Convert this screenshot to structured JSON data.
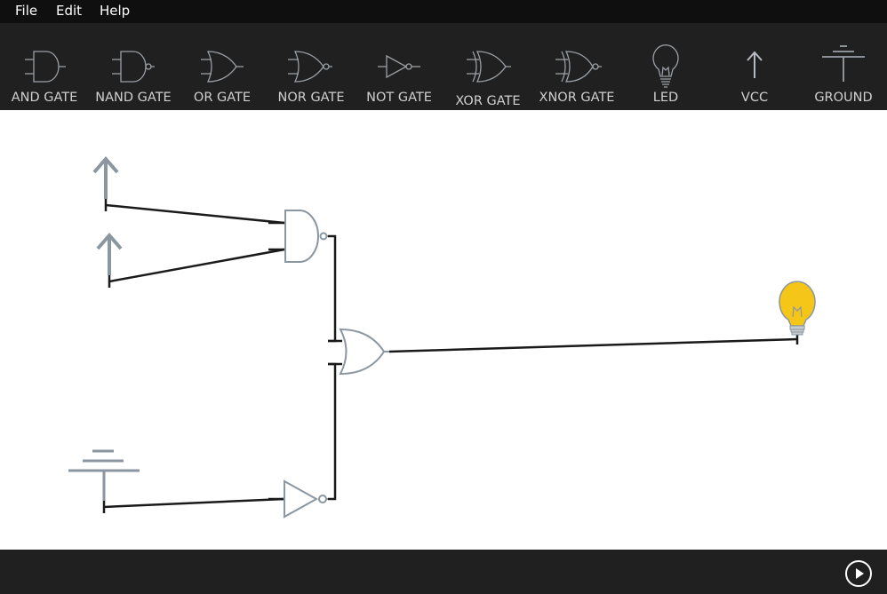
{
  "menubar": {
    "items": [
      {
        "label": "File"
      },
      {
        "label": "Edit"
      },
      {
        "label": "Help"
      }
    ]
  },
  "toolbar": {
    "tools": [
      {
        "label": "AND GATE",
        "icon": "and-gate-icon"
      },
      {
        "label": "NAND GATE",
        "icon": "nand-gate-icon"
      },
      {
        "label": "OR GATE",
        "icon": "or-gate-icon"
      },
      {
        "label": "NOR GATE",
        "icon": "nor-gate-icon"
      },
      {
        "label": "NOT GATE",
        "icon": "not-gate-icon"
      },
      {
        "label": "XOR GATE",
        "icon": "xor-gate-icon"
      },
      {
        "label": "XNOR GATE",
        "icon": "xnor-gate-icon"
      },
      {
        "label": "LED",
        "icon": "lightbulb-icon"
      },
      {
        "label": "VCC",
        "icon": "up-arrow-icon"
      },
      {
        "label": "GROUND",
        "icon": "ground-icon"
      }
    ]
  },
  "circuit": {
    "components": [
      "vcc",
      "vcc",
      "nand-gate",
      "or-gate",
      "not-gate",
      "ground",
      "led"
    ],
    "led_state": "on"
  },
  "bottombar": {
    "play_icon": "play-icon"
  },
  "colors": {
    "menubar_bg": "#0f0f0f",
    "toolbar_bg": "#202020",
    "tool_label": "#cfcfcf",
    "component_gray": "#8a96a0",
    "wire": "#1a1a1a",
    "led_on": "#f5c518"
  }
}
